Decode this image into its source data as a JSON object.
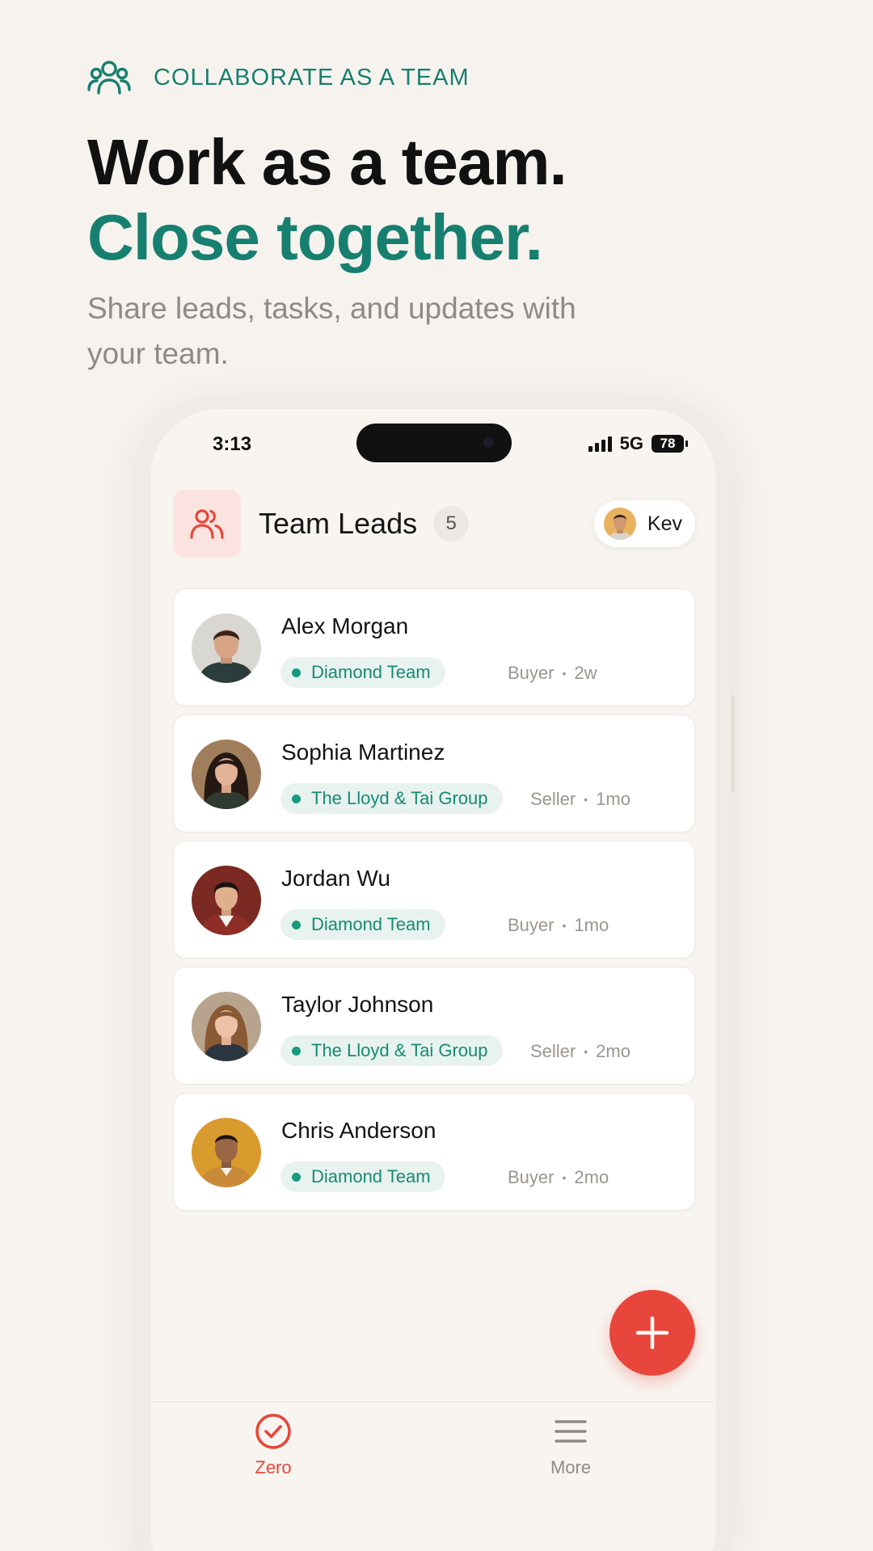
{
  "promo": {
    "eyebrow": "COLLABORATE AS A TEAM",
    "headline_line1": "Work as a team.",
    "headline_line2": "Close together.",
    "subhead": "Share leads, tasks, and updates with your team."
  },
  "status_bar": {
    "time": "3:13",
    "network": "5G",
    "battery": "78"
  },
  "header": {
    "title": "Team Leads",
    "count": "5",
    "user_name": "Kev"
  },
  "leads": [
    {
      "name": "Alex Morgan",
      "team": "Diamond Team",
      "type": "Buyer",
      "age": "2w"
    },
    {
      "name": "Sophia Martinez",
      "team": "The Lloyd & Tai Group",
      "type": "Seller",
      "age": "1mo"
    },
    {
      "name": "Jordan Wu",
      "team": "Diamond Team",
      "type": "Buyer",
      "age": "1mo"
    },
    {
      "name": "Taylor Johnson",
      "team": "The Lloyd & Tai Group",
      "type": "Seller",
      "age": "2mo"
    },
    {
      "name": "Chris Anderson",
      "team": "Diamond Team",
      "type": "Buyer",
      "age": "2mo"
    }
  ],
  "bottom_nav": {
    "zero_label": "Zero",
    "more_label": "More"
  },
  "colors": {
    "brand_teal": "#177f6f",
    "accent_red": "#e8463a",
    "team_pill_bg": "#e8f3ef"
  },
  "icons": {
    "eyebrow": "team-icon",
    "header": "team-leads-icon",
    "fab": "plus-icon",
    "nav_zero": "check-circle-icon",
    "nav_more": "menu-icon"
  }
}
